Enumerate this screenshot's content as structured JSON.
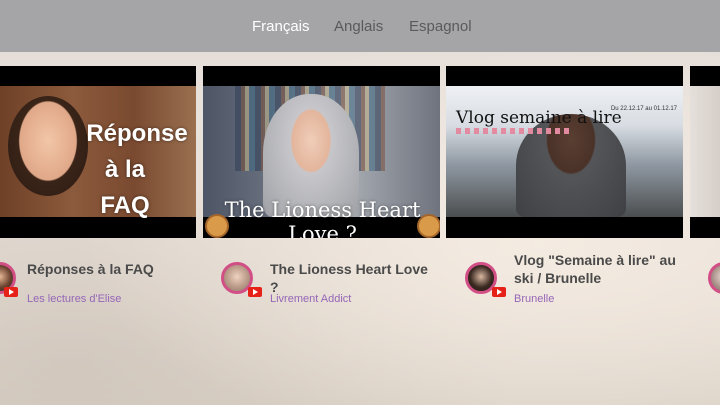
{
  "tabs": [
    {
      "label": "Français",
      "active": true
    },
    {
      "label": "Anglais",
      "active": false
    },
    {
      "label": "Espagnol",
      "active": false
    }
  ],
  "videos": [
    {
      "title": "Réponses à la FAQ",
      "channel": "Les lectures d'Elise",
      "thumbnail_text": [
        "Réponse",
        "à la",
        "FAQ"
      ]
    },
    {
      "title": "The Lioness Heart Love ?",
      "channel": "Livrement Addict",
      "thumbnail_text": "The Lioness Heart Love ?"
    },
    {
      "title": "Vlog \"Semaine à lire\" au ski / Brunelle",
      "channel": "Brunelle",
      "thumbnail_text": "Vlog semaine à lire",
      "thumbnail_date": "Du 22.12.17 au 01.12.17"
    }
  ],
  "colors": {
    "topbar": "#a5a4a6",
    "active_tab": "#ffffff",
    "inactive_tab": "#5a5a5e",
    "channel_text": "#9566b8",
    "avatar_ring": "#d24f86",
    "youtube_badge": "#e62117"
  }
}
